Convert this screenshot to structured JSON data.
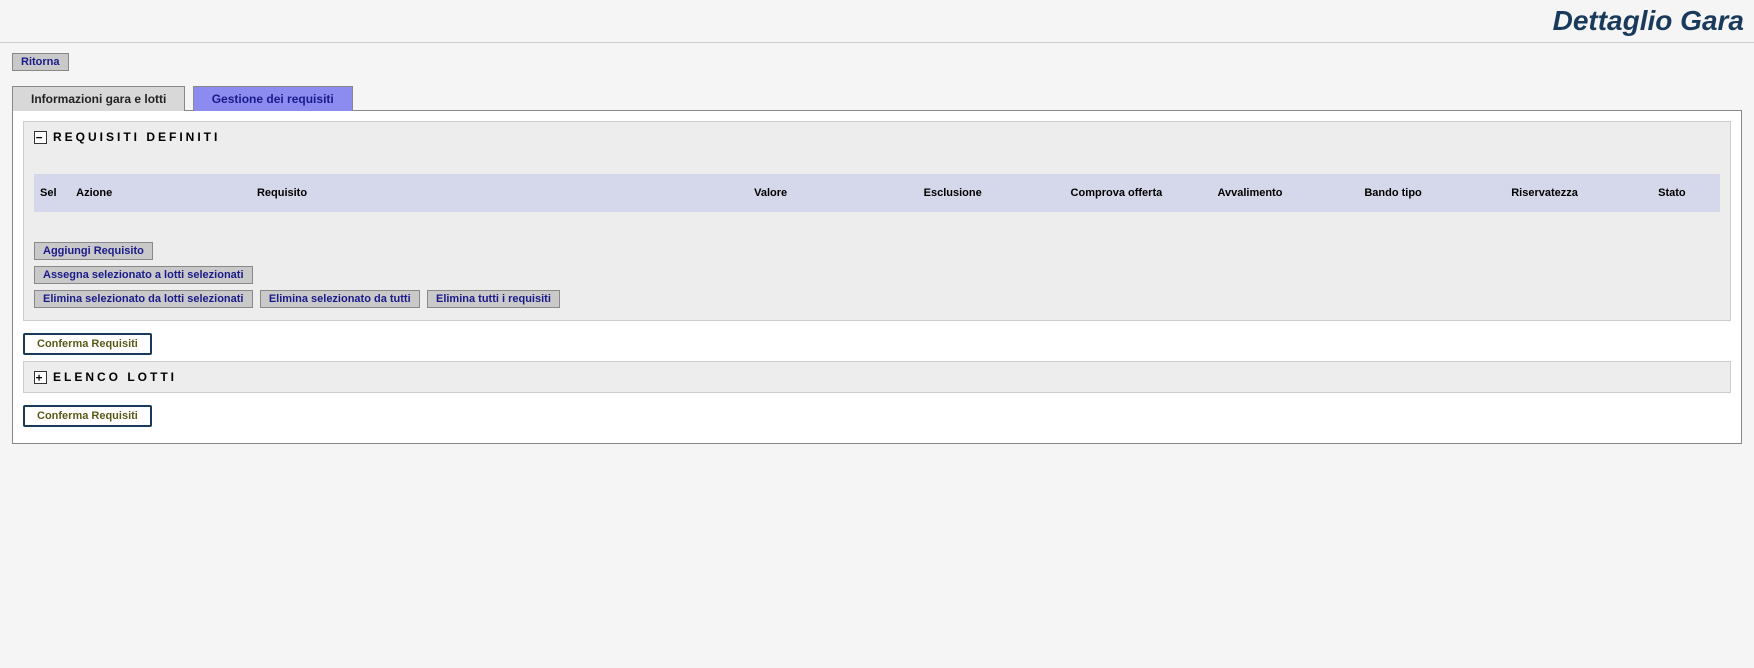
{
  "header": {
    "title": "Dettaglio Gara"
  },
  "topbar": {
    "return_label": "Ritorna"
  },
  "tabs": {
    "info": "Informazioni gara e lotti",
    "gestione": "Gestione dei requisiti"
  },
  "section_requisiti": {
    "title": "REQUISITI DEFINITI",
    "toggle_symbol": "−",
    "columns": {
      "sel": "Sel",
      "azione": "Azione",
      "requisito": "Requisito",
      "valore": "Valore",
      "esclusione": "Esclusione",
      "comprova": "Comprova offerta",
      "avvalimento": "Avvalimento",
      "bando": "Bando tipo",
      "riservatezza": "Riservatezza",
      "stato": "Stato"
    },
    "buttons": {
      "aggiungi": "Aggiungi Requisito",
      "assegna": "Assegna selezionato a lotti selezionati",
      "elimina_sel_lotti": "Elimina selezionato da lotti selezionati",
      "elimina_sel_tutti": "Elimina selezionato da tutti",
      "elimina_tutti": "Elimina tutti i requisiti"
    }
  },
  "confirm_button": "Conferma Requisiti",
  "section_lotti": {
    "title": "ELENCO LOTTI",
    "toggle_symbol": "+"
  }
}
